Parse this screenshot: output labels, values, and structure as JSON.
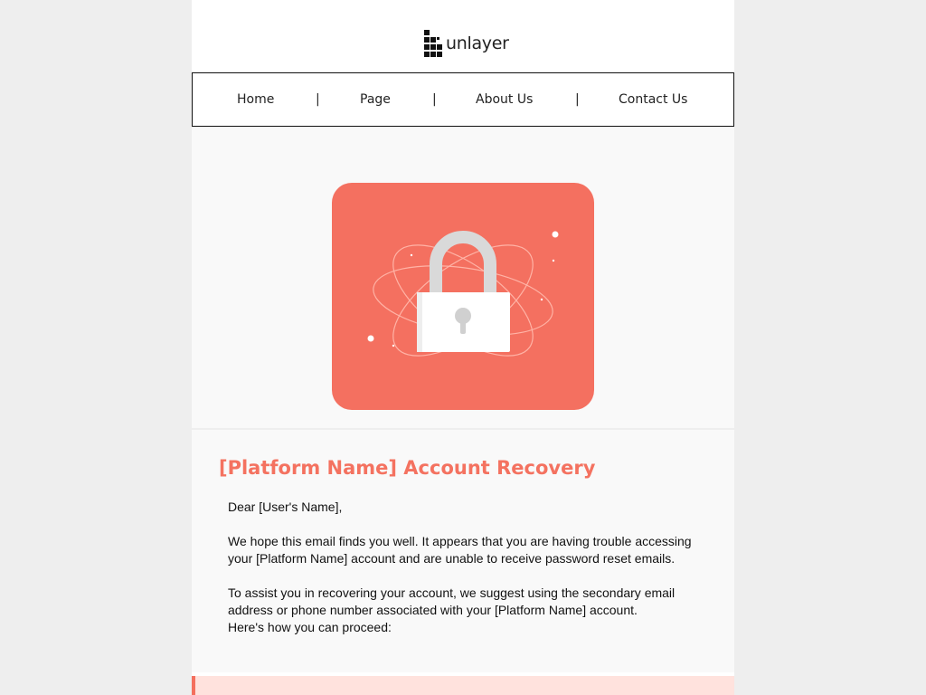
{
  "brand": {
    "logo_text": "unlayer"
  },
  "nav": {
    "items": [
      {
        "label": "Home"
      },
      {
        "label": "Page"
      },
      {
        "label": "About Us"
      },
      {
        "label": "Contact Us"
      }
    ],
    "separator": "|"
  },
  "hero": {
    "illustration": "padlock-illustration",
    "background_color": "#f47060"
  },
  "content": {
    "title": "[Platform Name] Account Recovery",
    "greeting": "Dear [User's Name],",
    "paragraph_1": "We hope this email finds you well. It appears that you are having trouble accessing your [Platform Name] account and are unable to receive password reset emails.",
    "paragraph_2": "To assist you in recovering your account, we suggest using the secondary email address or phone number associated with your [Platform Name] account.",
    "paragraph_3": "Here's how you can proceed:"
  },
  "colors": {
    "accent": "#f47260",
    "callout_bg": "#ffe2dd",
    "callout_border": "#f46f5e"
  }
}
